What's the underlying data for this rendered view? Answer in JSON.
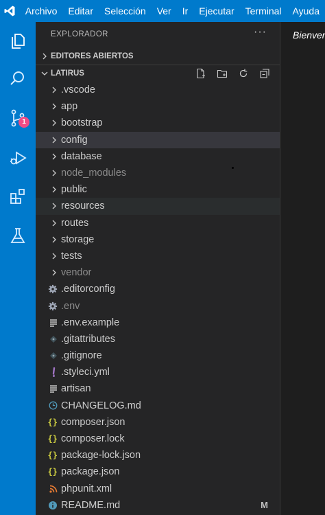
{
  "menubar": {
    "items": [
      "Archivo",
      "Editar",
      "Selección",
      "Ver",
      "Ir",
      "Ejecutar",
      "Terminal",
      "Ayuda"
    ]
  },
  "activitybar": {
    "icons": [
      "files-icon",
      "search-icon",
      "source-control-icon",
      "run-debug-icon",
      "extensions-icon",
      "testing-icon"
    ],
    "source_control_badge": "1"
  },
  "sidebar": {
    "title": "EXPLORADOR",
    "more": "···",
    "open_editors": "EDITORES ABIERTOS",
    "workspace": "LATIRUS",
    "items": [
      {
        "label": ".vscode",
        "kind": "folder"
      },
      {
        "label": "app",
        "kind": "folder"
      },
      {
        "label": "bootstrap",
        "kind": "folder"
      },
      {
        "label": "config",
        "kind": "folder",
        "state": "selected"
      },
      {
        "label": "database",
        "kind": "folder"
      },
      {
        "label": "node_modules",
        "kind": "folder",
        "state": "dimmed"
      },
      {
        "label": "public",
        "kind": "folder"
      },
      {
        "label": "resources",
        "kind": "folder",
        "state": "hover"
      },
      {
        "label": "routes",
        "kind": "folder"
      },
      {
        "label": "storage",
        "kind": "folder"
      },
      {
        "label": "tests",
        "kind": "folder"
      },
      {
        "label": "vendor",
        "kind": "folder",
        "state": "dimmed"
      },
      {
        "label": ".editorconfig",
        "kind": "gear"
      },
      {
        "label": ".env",
        "kind": "gear",
        "state": "dimmed"
      },
      {
        "label": ".env.example",
        "kind": "lines"
      },
      {
        "label": ".gitattributes",
        "kind": "git"
      },
      {
        "label": ".gitignore",
        "kind": "git"
      },
      {
        "label": ".styleci.yml",
        "kind": "yaml"
      },
      {
        "label": "artisan",
        "kind": "lines"
      },
      {
        "label": "CHANGELOG.md",
        "kind": "clock"
      },
      {
        "label": "composer.json",
        "kind": "json"
      },
      {
        "label": "composer.lock",
        "kind": "json"
      },
      {
        "label": "package-lock.json",
        "kind": "json"
      },
      {
        "label": "package.json",
        "kind": "json"
      },
      {
        "label": "phpunit.xml",
        "kind": "rss"
      },
      {
        "label": "README.md",
        "kind": "info",
        "decoration": "M"
      }
    ]
  },
  "editor": {
    "tab_label": "Bienvenida"
  },
  "colors": {
    "accent": "#007acc",
    "badge": "#f14c86",
    "json": "#cbcb41",
    "yaml": "#a074c4",
    "rss": "#e37933",
    "info": "#519aba"
  }
}
